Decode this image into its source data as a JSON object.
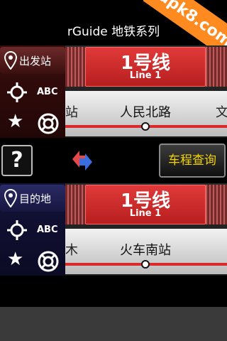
{
  "app": {
    "title": "rGuide 地铁系列",
    "watermark": "apk8.com"
  },
  "departure": {
    "label": "出发站",
    "line_number": "1号线",
    "line_english": "Line 1",
    "station": "人民北路",
    "edge_left": "站",
    "edge_right": "文",
    "gps_label": "ABC",
    "panel_color": "#3a0d0d"
  },
  "destination": {
    "label": "目的地",
    "line_number": "1号线",
    "line_english": "Line 1",
    "station": "火车南站",
    "edge_left": "木",
    "panel_color": "#13123a"
  },
  "controls": {
    "help_label": "?",
    "query_label": "车程查询",
    "swap_icon": "swap-arrows-icon"
  },
  "colors": {
    "line_red": "#d92b2b",
    "query_text": "#f4d400"
  }
}
